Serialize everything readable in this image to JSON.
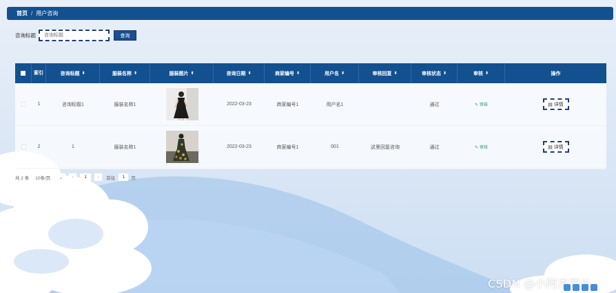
{
  "breadcrumb": {
    "home": "首页",
    "separator": "/",
    "current": "用户咨询"
  },
  "search": {
    "label": "咨询标题",
    "placeholder": "咨询标题",
    "button": "查询"
  },
  "table": {
    "headers": [
      "",
      "索引",
      "咨询标题",
      "服装名称",
      "服装图片",
      "咨询日期",
      "商家编号",
      "用户名",
      "审核回复",
      "审核状态",
      "审核",
      "操作"
    ],
    "sortable": [
      false,
      false,
      true,
      true,
      true,
      true,
      true,
      true,
      true,
      true,
      true,
      false
    ],
    "rows": [
      {
        "index": "1",
        "title": "咨询标题1",
        "name": "服装名称1",
        "date": "2022-03-23",
        "merchant": "商家编号1",
        "user": "用户名1",
        "reply": "",
        "status": "通过",
        "audit": "审核",
        "action": "详情"
      },
      {
        "index": "2",
        "title": "1",
        "name": "服装名称1",
        "date": "2022-03-23",
        "merchant": "商家编号1",
        "user": "001",
        "reply": "这里回复咨询",
        "status": "通过",
        "audit": "审核",
        "action": "详情"
      }
    ]
  },
  "pager": {
    "total": "共 2 条",
    "page_size": "10条/页",
    "current_page": "1",
    "goto_label": "前往",
    "goto_value": "1",
    "page_unit": "页"
  },
  "watermark": "CSDN @小阿杰学长",
  "icons": {
    "sort": "sort-icon",
    "edit": "pen-icon",
    "detail": "doc-icon"
  },
  "colors": {
    "primary": "#13508f",
    "audit_link": "#2a9d6a",
    "background": "#e6edf8"
  }
}
